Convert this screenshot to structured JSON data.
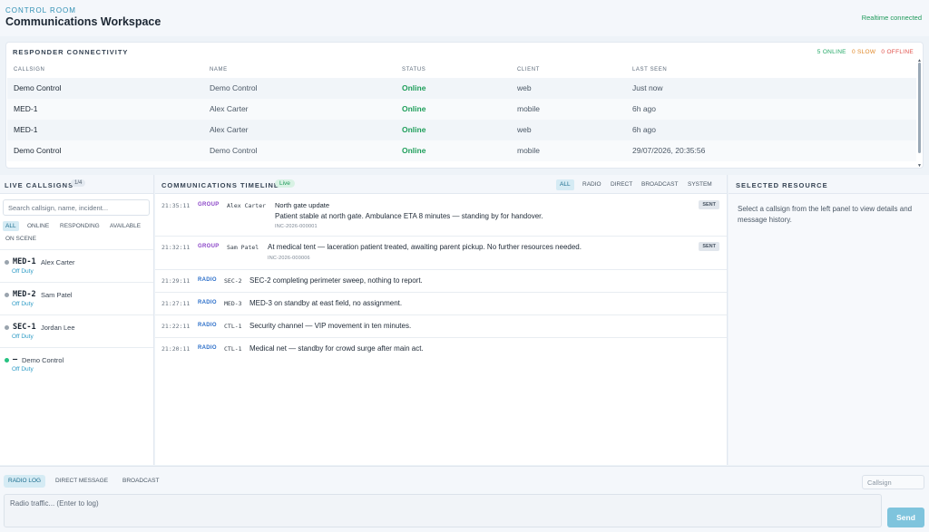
{
  "header": {
    "eyebrow": "CONTROL ROOM",
    "title": "Communications Workspace",
    "realtime_status": "Realtime connected"
  },
  "connectivity": {
    "title": "RESPONDER CONNECTIVITY",
    "summary": {
      "online": "5 ONLINE",
      "slow": "0 SLOW",
      "offline": "0 OFFLINE"
    },
    "columns": [
      "CALLSIGN",
      "NAME",
      "STATUS",
      "CLIENT",
      "LAST SEEN"
    ],
    "rows": [
      {
        "callsign": "Demo Control",
        "name": "Demo Control",
        "status": "Online",
        "client": "web",
        "last_seen": "Just now"
      },
      {
        "callsign": "MED-1",
        "name": "Alex Carter",
        "status": "Online",
        "client": "mobile",
        "last_seen": "6h ago"
      },
      {
        "callsign": "MED-1",
        "name": "Alex Carter",
        "status": "Online",
        "client": "web",
        "last_seen": "6h ago"
      },
      {
        "callsign": "Demo Control",
        "name": "Demo Control",
        "status": "Online",
        "client": "mobile",
        "last_seen": "29/07/2026, 20:35:56"
      }
    ]
  },
  "live_callsigns": {
    "title": "LIVE CALLSIGNS",
    "count": "1/4",
    "search_placeholder": "Search callsign, name, incident...",
    "filters": [
      "ALL",
      "ONLINE",
      "RESPONDING",
      "AVAILABLE",
      "ON SCENE"
    ],
    "items": [
      {
        "code": "MED-1",
        "name": "Alex Carter",
        "status": "Off Duty",
        "online": false
      },
      {
        "code": "MED-2",
        "name": "Sam Patel",
        "status": "Off Duty",
        "online": false
      },
      {
        "code": "SEC-1",
        "name": "Jordan Lee",
        "status": "Off Duty",
        "online": false
      },
      {
        "code": "—",
        "name": "Demo Control",
        "status": "Off Duty",
        "online": true
      }
    ]
  },
  "timeline": {
    "title": "COMMUNICATIONS TIMELINE",
    "live_label": "Live",
    "tabs": [
      "ALL",
      "RADIO",
      "DIRECT",
      "BROADCAST",
      "SYSTEM"
    ],
    "entries": [
      {
        "time": "21:35:11",
        "channel": "GROUP",
        "from": "Alex Carter",
        "subject": "North gate update",
        "message": "Patient stable at north gate. Ambulance ETA 8 minutes — standing by for handover.",
        "incident": "INC-2026-000001",
        "badge": "SENT"
      },
      {
        "time": "21:32:11",
        "channel": "GROUP",
        "from": "Sam Patel",
        "message": "At medical tent — laceration patient treated, awaiting parent pickup. No further resources needed.",
        "incident": "INC-2026-000006",
        "badge": "SENT"
      },
      {
        "time": "21:29:11",
        "channel": "RADIO",
        "from": "SEC-2",
        "message": "SEC-2 completing perimeter sweep, nothing to report."
      },
      {
        "time": "21:27:11",
        "channel": "RADIO",
        "from": "MED-3",
        "message": "MED-3 on standby at east field, no assignment."
      },
      {
        "time": "21:22:11",
        "channel": "RADIO",
        "from": "CTL-1",
        "message": "Security channel — VIP movement in ten minutes."
      },
      {
        "time": "21:20:11",
        "channel": "RADIO",
        "from": "CTL-1",
        "message": "Medical net — standby for crowd surge after main act."
      }
    ]
  },
  "resource": {
    "title": "SELECTED RESOURCE",
    "hint": "Select a callsign from the left panel to view details and message history."
  },
  "composer": {
    "tabs": [
      "RADIO LOG",
      "DIRECT MESSAGE",
      "BROADCAST"
    ],
    "callsign_placeholder": "Callsign",
    "traffic_placeholder": "Radio traffic... (Enter to log)",
    "send_label": "Send"
  },
  "colors": {
    "accent": "#2f8fb3",
    "online": "#1e9e5a",
    "slow": "#e0892a",
    "offline": "#e0504a",
    "group_channel": "#8b45c8",
    "radio_channel": "#2c6fc9",
    "send_button": "#7fc4dd"
  }
}
